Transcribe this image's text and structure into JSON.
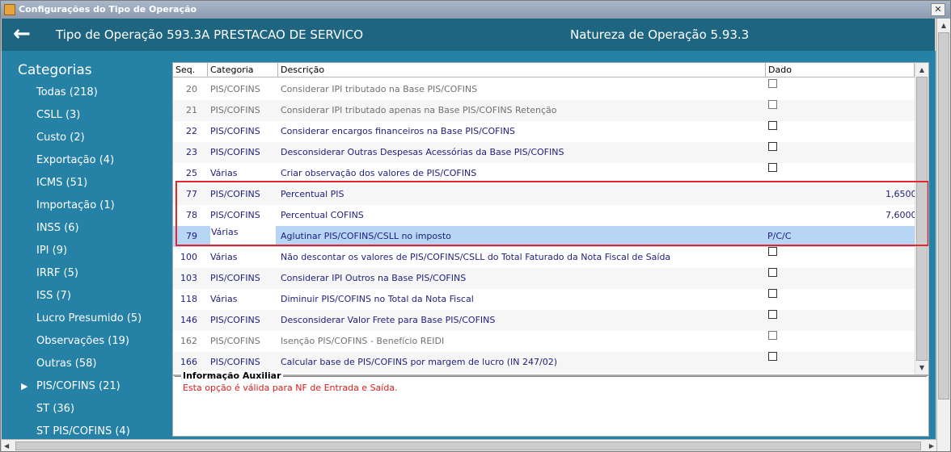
{
  "window": {
    "title": "Configurações do Tipo de Operação",
    "close_label": "✕"
  },
  "header": {
    "back_icon": "←",
    "tipo_operacao": "Tipo de Operação 593.3A  PRESTACAO DE SERVICO",
    "natureza_operacao": "Natureza de Operação 5.93.3"
  },
  "sidebar": {
    "heading": "Categorias",
    "items": [
      {
        "label": "Todas (218)"
      },
      {
        "label": "CSLL (3)"
      },
      {
        "label": "Custo (2)"
      },
      {
        "label": "Exportação (4)"
      },
      {
        "label": "ICMS (51)"
      },
      {
        "label": "Importação (1)"
      },
      {
        "label": "INSS (6)"
      },
      {
        "label": "IPI (9)"
      },
      {
        "label": "IRRF (5)"
      },
      {
        "label": "ISS (7)"
      },
      {
        "label": "Lucro Presumido (5)"
      },
      {
        "label": "Observações (19)"
      },
      {
        "label": "Outras (58)"
      },
      {
        "label": "PIS/COFINS (21)",
        "selected": true
      },
      {
        "label": "ST (36)"
      },
      {
        "label": "ST PIS/COFINS (4)"
      }
    ]
  },
  "grid": {
    "columns": {
      "seq": "Seq.",
      "categoria": "Categoria",
      "descricao": "Descrição",
      "dado": "Dado"
    },
    "rows": [
      {
        "seq": "20",
        "categoria": "PIS/COFINS",
        "descricao": "Considerar IPI tributado na Base PIS/COFINS",
        "dado_type": "checkbox",
        "style": "gray"
      },
      {
        "seq": "21",
        "categoria": "PIS/COFINS",
        "descricao": "Considerar IPI tributado apenas na Base PIS/COFINS Retenção",
        "dado_type": "checkbox",
        "style": "gray"
      },
      {
        "seq": "22",
        "categoria": "PIS/COFINS",
        "descricao": "Considerar encargos financeiros na Base PIS/COFINS",
        "dado_type": "checkbox",
        "style": "blue"
      },
      {
        "seq": "23",
        "categoria": "PIS/COFINS",
        "descricao": "Desconsiderar Outras Despesas Acessórias da Base PIS/COFINS",
        "dado_type": "checkbox",
        "style": "blue"
      },
      {
        "seq": "25",
        "categoria": "Várias",
        "descricao": "Criar observação dos valores de PIS/COFINS",
        "dado_type": "checkbox",
        "style": "blue"
      },
      {
        "seq": "77",
        "categoria": "PIS/COFINS",
        "descricao": "Percentual PIS",
        "dado_type": "value",
        "dado": "1,6500%",
        "style": "blue"
      },
      {
        "seq": "78",
        "categoria": "PIS/COFINS",
        "descricao": "Percentual COFINS",
        "dado_type": "value",
        "dado": "7,6000%",
        "style": "blue"
      },
      {
        "seq": "79",
        "categoria": "Várias",
        "descricao": "Aglutinar PIS/COFINS/CSLL no imposto",
        "dado_type": "text",
        "dado": "P/C/C",
        "style": "blue",
        "selected": true
      },
      {
        "seq": "100",
        "categoria": "Várias",
        "descricao": "Não descontar os valores de PIS/COFINS/CSLL do Total Faturado da Nota Fiscal de Saída",
        "dado_type": "checkbox",
        "style": "blue"
      },
      {
        "seq": "103",
        "categoria": "PIS/COFINS",
        "descricao": "Considerar IPI Outros na Base PIS/COFINS",
        "dado_type": "checkbox",
        "style": "blue"
      },
      {
        "seq": "118",
        "categoria": "Várias",
        "descricao": "Diminuir PIS/COFINS no Total da Nota Fiscal",
        "dado_type": "checkbox",
        "style": "blue"
      },
      {
        "seq": "146",
        "categoria": "PIS/COFINS",
        "descricao": "Desconsiderar Valor Frete para Base PIS/COFINS",
        "dado_type": "checkbox",
        "style": "blue"
      },
      {
        "seq": "162",
        "categoria": "PIS/COFINS",
        "descricao": "Isenção PIS/COFINS - Benefício REIDI",
        "dado_type": "checkbox",
        "style": "gray"
      },
      {
        "seq": "166",
        "categoria": "PIS/COFINS",
        "descricao": "Calcular base de PIS/COFINS por margem de lucro (IN 247/02)",
        "dado_type": "checkbox",
        "style": "blue"
      }
    ]
  },
  "aux": {
    "title": "Informação Auxiliar",
    "text": "Esta opção é válida para NF de Entrada e Saída."
  },
  "colors": {
    "header_bg": "#1d6580",
    "sidebar_bg": "#2581a5",
    "selected_row": "#b7d5f4",
    "highlight_border": "#e0262e",
    "aux_text": "#d81d1d"
  }
}
